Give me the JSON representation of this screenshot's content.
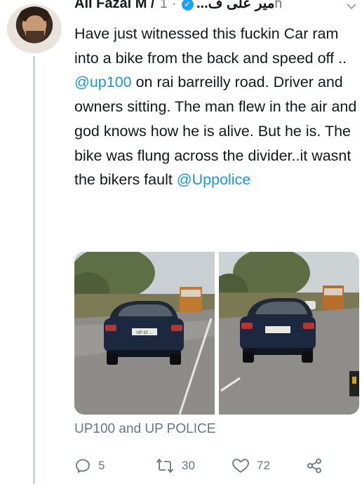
{
  "tweet": {
    "author_name": "Ali Fazal M / میر علی ف...",
    "separator": "·",
    "time": "1h",
    "text_segments": [
      {
        "text": "Have just witnessed this fuckin Car ram into a bike from the back and speed off .. ",
        "type": "text"
      },
      {
        "text": "@up100",
        "type": "mention"
      },
      {
        "text": " on rai barreilly road. Driver and owners sitting. The man flew in the air and god knows how he is alive. But he is. The bike was flung across the divider..it wasnt the bikers fault ",
        "type": "text"
      },
      {
        "text": "@Uppolice",
        "type": "mention"
      }
    ],
    "card_label": "UP100 and UP POLICE",
    "plate_text": "UP 32 ...",
    "replies": "5",
    "retweets": "30",
    "likes": "72"
  },
  "icons": {
    "verified": "verified-badge-icon",
    "caret": "chevron-down-icon",
    "reply": "reply-icon",
    "retweet": "retweet-icon",
    "like": "heart-icon",
    "share": "share-icon"
  },
  "colors": {
    "link": "#1b95e0",
    "muted": "#657786",
    "verified": "#1da1f2",
    "text": "#14171a"
  }
}
